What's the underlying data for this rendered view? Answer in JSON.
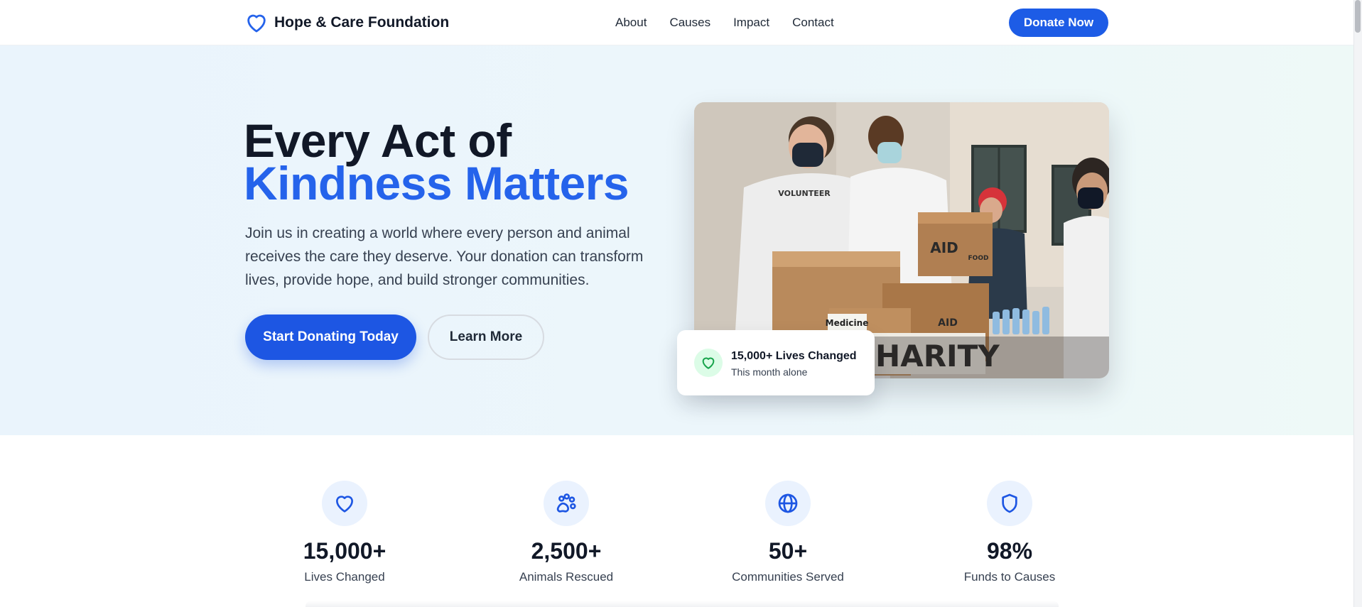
{
  "brand": {
    "name": "Hope & Care Foundation",
    "icon": "heart-icon",
    "color": "#2563eb"
  },
  "nav": {
    "items": [
      "About",
      "Causes",
      "Impact",
      "Contact"
    ]
  },
  "header": {
    "cta_label": "Donate Now"
  },
  "hero": {
    "title_line1": "Every Act of",
    "title_line2": "Kindness Matters",
    "description": "Join us in creating a world where every person and animal receives the care they deserve. Your donation can transform lives, provide hope, and build stronger communities.",
    "primary_cta": "Start Donating Today",
    "secondary_cta": "Learn More",
    "photo_alt": "Volunteers packing aid boxes",
    "photo_labels": {
      "medicine": "Medicine",
      "charity": "CHARITY",
      "aid_1": "AID",
      "aid_2": "AID",
      "food": "FOOD",
      "volunteer": "VOLUNTEER"
    }
  },
  "highlight_card": {
    "icon": "heart-icon",
    "title": "15,000+ Lives Changed",
    "subtitle": "This month alone"
  },
  "stats": [
    {
      "icon": "heart-icon",
      "value": "15,000+",
      "label": "Lives Changed"
    },
    {
      "icon": "paw-icon",
      "value": "2,500+",
      "label": "Animals Rescued"
    },
    {
      "icon": "globe-icon",
      "value": "50+",
      "label": "Communities Served"
    },
    {
      "icon": "shield-icon",
      "value": "98%",
      "label": "Funds to Causes"
    }
  ],
  "colors": {
    "primary": "#1d56e3",
    "accent_green": "#16a34a",
    "hero_bg": "#eaf4fc"
  }
}
